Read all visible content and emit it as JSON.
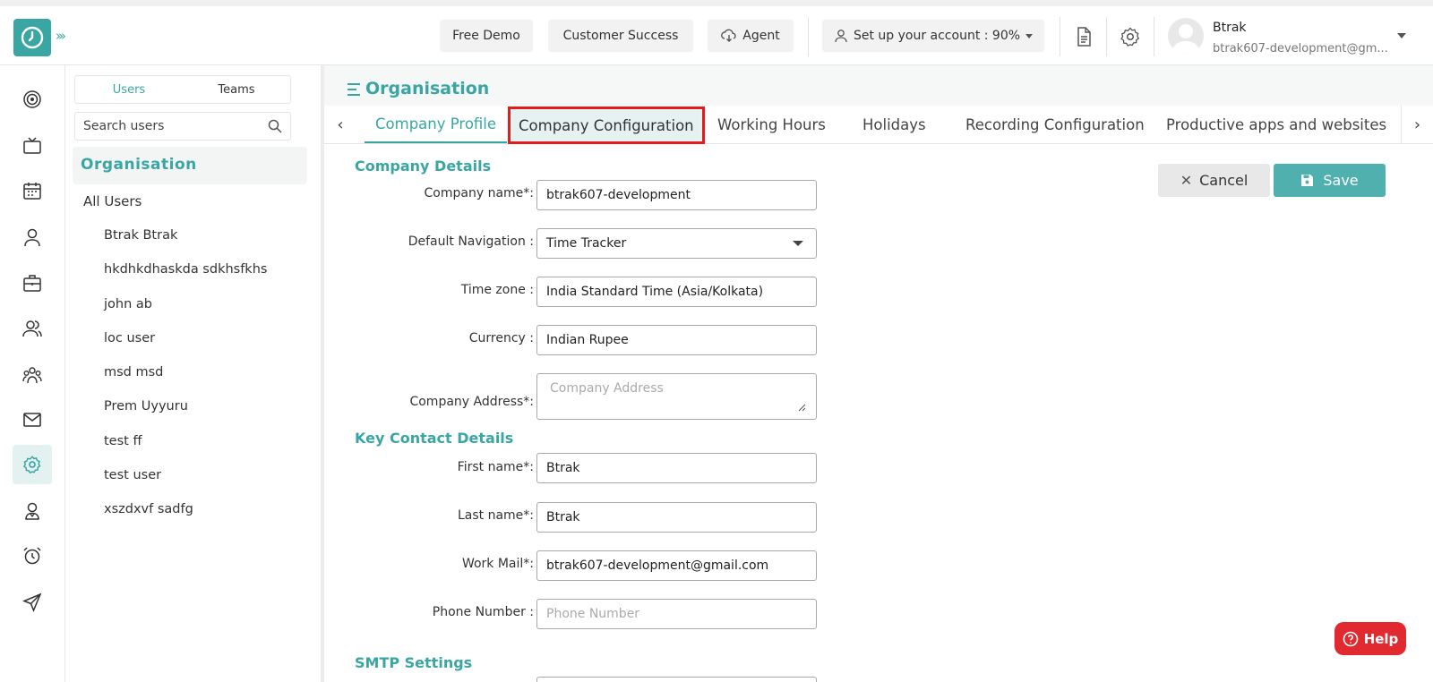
{
  "topbar": {
    "free_demo": "Free Demo",
    "customer_success": "Customer Success",
    "agent": "Agent",
    "setup": "Set up your account : 90%",
    "user_name": "Btrak",
    "user_email": "btrak607-development@gm..."
  },
  "users_panel": {
    "tabs": [
      "Users",
      "Teams"
    ],
    "search_placeholder": "Search users",
    "org_title": "Organisation",
    "all_users": "All Users",
    "users": [
      "Btrak Btrak",
      "hkdhkdhaskda sdkhsfkhs",
      "john ab",
      "loc user",
      "msd msd",
      "Prem Uyyuru",
      "test ff",
      "test user",
      "xszdxvf sadfg"
    ]
  },
  "page": {
    "title": "Organisation",
    "tabs": [
      "Company Profile",
      "Company Configuration",
      "Working Hours",
      "Holidays",
      "Recording Configuration",
      "Productive apps and websites"
    ]
  },
  "form": {
    "company_details": "Company Details",
    "company_name_label": "Company name*:",
    "company_name": "btrak607-development",
    "default_nav_label": "Default Navigation :",
    "default_nav": "Time Tracker",
    "timezone_label": "Time zone :",
    "timezone": "India Standard Time (Asia/Kolkata)",
    "currency_label": "Currency :",
    "currency": "Indian Rupee",
    "address_label": "Company Address*:",
    "address_placeholder": "Company Address",
    "key_contact": "Key Contact Details",
    "first_name_label": "First name*:",
    "first_name": "Btrak",
    "last_name_label": "Last name*:",
    "last_name": "Btrak",
    "work_mail_label": "Work Mail*:",
    "work_mail": "btrak607-development@gmail.com",
    "phone_label": "Phone Number :",
    "phone_placeholder": "Phone Number",
    "smtp": "SMTP Settings"
  },
  "actions": {
    "cancel": "Cancel",
    "save": "Save",
    "help": "Help"
  },
  "colors": {
    "accent": "#3aa6a4",
    "highlight_border": "#e21b1b",
    "help": "#e02a2f"
  }
}
